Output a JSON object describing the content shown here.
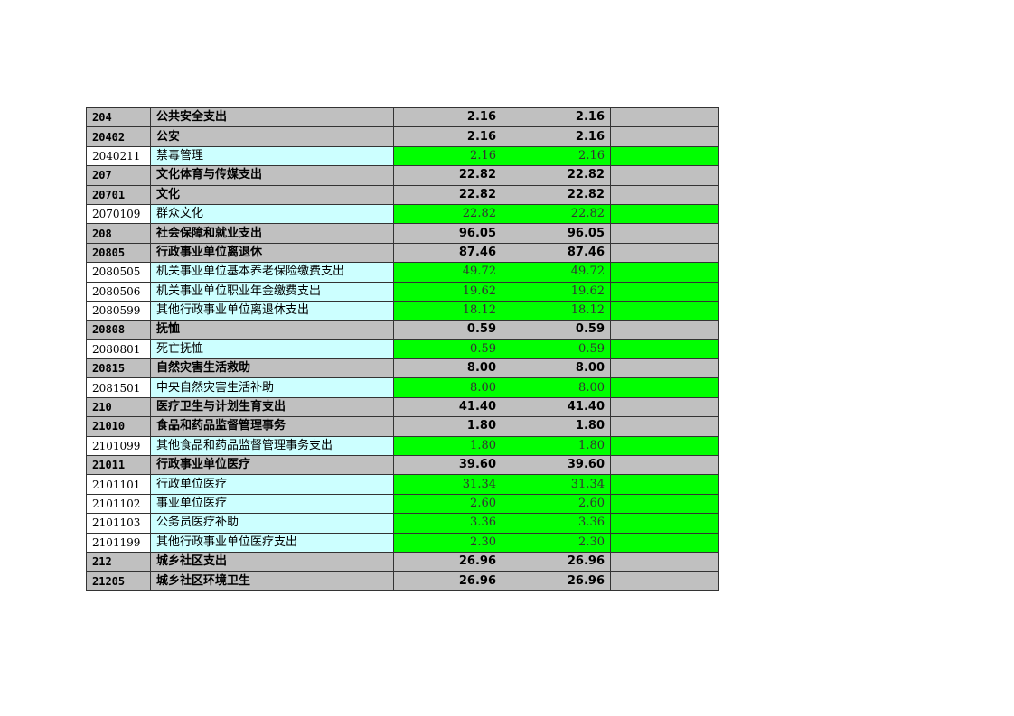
{
  "rows": [
    {
      "code": "204",
      "name": "公共安全支出",
      "v1": "2.16",
      "v2": "2.16",
      "level": "hdr"
    },
    {
      "code": "20402",
      "name": "公安",
      "v1": "2.16",
      "v2": "2.16",
      "level": "hdr"
    },
    {
      "code": "2040211",
      "name": "禁毒管理",
      "v1": "2.16",
      "v2": "2.16",
      "level": "leaf"
    },
    {
      "code": "207",
      "name": "文化体育与传媒支出",
      "v1": "22.82",
      "v2": "22.82",
      "level": "hdr"
    },
    {
      "code": "20701",
      "name": "文化",
      "v1": "22.82",
      "v2": "22.82",
      "level": "hdr"
    },
    {
      "code": "2070109",
      "name": "群众文化",
      "v1": "22.82",
      "v2": "22.82",
      "level": "leaf"
    },
    {
      "code": "208",
      "name": "社会保障和就业支出",
      "v1": "96.05",
      "v2": "96.05",
      "level": "hdr"
    },
    {
      "code": "20805",
      "name": "行政事业单位离退休",
      "v1": "87.46",
      "v2": "87.46",
      "level": "hdr"
    },
    {
      "code": "2080505",
      "name": "机关事业单位基本养老保险缴费支出",
      "v1": "49.72",
      "v2": "49.72",
      "level": "leaf"
    },
    {
      "code": "2080506",
      "name": "机关事业单位职业年金缴费支出",
      "v1": "19.62",
      "v2": "19.62",
      "level": "leaf"
    },
    {
      "code": "2080599",
      "name": "其他行政事业单位离退休支出",
      "v1": "18.12",
      "v2": "18.12",
      "level": "leaf"
    },
    {
      "code": "20808",
      "name": "抚恤",
      "v1": "0.59",
      "v2": "0.59",
      "level": "hdr"
    },
    {
      "code": "2080801",
      "name": "死亡抚恤",
      "v1": "0.59",
      "v2": "0.59",
      "level": "leaf"
    },
    {
      "code": "20815",
      "name": "自然灾害生活救助",
      "v1": "8.00",
      "v2": "8.00",
      "level": "hdr"
    },
    {
      "code": "2081501",
      "name": "中央自然灾害生活补助",
      "v1": "8.00",
      "v2": "8.00",
      "level": "leaf"
    },
    {
      "code": "210",
      "name": "医疗卫生与计划生育支出",
      "v1": "41.40",
      "v2": "41.40",
      "level": "hdr"
    },
    {
      "code": "21010",
      "name": "食品和药品监督管理事务",
      "v1": "1.80",
      "v2": "1.80",
      "level": "hdr"
    },
    {
      "code": "2101099",
      "name": "其他食品和药品监督管理事务支出",
      "v1": "1.80",
      "v2": "1.80",
      "level": "leaf"
    },
    {
      "code": "21011",
      "name": "行政事业单位医疗",
      "v1": "39.60",
      "v2": "39.60",
      "level": "hdr"
    },
    {
      "code": "2101101",
      "name": "行政单位医疗",
      "v1": "31.34",
      "v2": "31.34",
      "level": "leaf"
    },
    {
      "code": "2101102",
      "name": "事业单位医疗",
      "v1": "2.60",
      "v2": "2.60",
      "level": "leaf"
    },
    {
      "code": "2101103",
      "name": "公务员医疗补助",
      "v1": "3.36",
      "v2": "3.36",
      "level": "leaf"
    },
    {
      "code": "2101199",
      "name": "其他行政事业单位医疗支出",
      "v1": "2.30",
      "v2": "2.30",
      "level": "leaf"
    },
    {
      "code": "212",
      "name": "城乡社区支出",
      "v1": "26.96",
      "v2": "26.96",
      "level": "hdr"
    },
    {
      "code": "21205",
      "name": "城乡社区环境卫生",
      "v1": "26.96",
      "v2": "26.96",
      "level": "hdr"
    }
  ],
  "colors": {
    "header_bg": "#c0c0c0",
    "leaf_name_bg": "#ccffff",
    "leaf_value_bg": "#00ff00"
  }
}
